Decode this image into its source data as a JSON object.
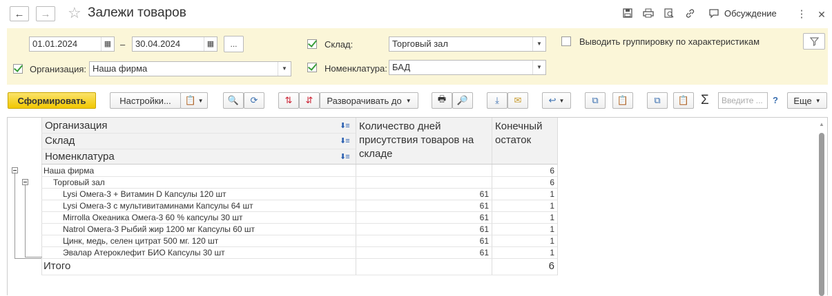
{
  "window": {
    "title": "Залежи товаров",
    "discussion_label": "Обсуждение"
  },
  "filters": {
    "date_from": "01.01.2024",
    "date_separator": "–",
    "date_to": "30.04.2024",
    "period_button": "...",
    "organization": {
      "checked": true,
      "label": "Организация:",
      "value": "Наша фирма"
    },
    "warehouse": {
      "checked": true,
      "label": "Склад:",
      "value": "Торговый зал"
    },
    "nomenclature": {
      "checked": true,
      "label": "Номенклатура:",
      "value": "БАД"
    },
    "grouping": {
      "checked": false,
      "label": "Выводить группировку по характеристикам"
    }
  },
  "toolbar": {
    "generate": "Сформировать",
    "settings": "Настройки...",
    "expand_to": "Разворачивать до",
    "search_placeholder": "Введите ...",
    "help": "?",
    "more": "Еще",
    "sum_symbol": "Σ"
  },
  "report": {
    "headers": {
      "group1": "Организация",
      "group2": "Склад",
      "group3": "Номенклатура",
      "days": "Количество дней присутствия товаров на складе",
      "balance": "Конечный остаток"
    },
    "organization_row": {
      "name": "Наша фирма",
      "days": "",
      "balance": "6"
    },
    "warehouse_row": {
      "name": "Торговый зал",
      "days": "",
      "balance": "6"
    },
    "items": [
      {
        "name": "Lysi Омега-3 + Витамин D Капсулы 120 шт",
        "days": "61",
        "balance": "1"
      },
      {
        "name": "Lysi Омега-3 с мультивитаминами Капсулы 64 шт",
        "days": "61",
        "balance": "1"
      },
      {
        "name": "Mirrolla Океаника Омега-3 60 % капсулы 30 шт",
        "days": "61",
        "balance": "1"
      },
      {
        "name": "Natrol Омега-3 Рыбий жир 1200 мг Капсулы 60 шт",
        "days": "61",
        "balance": "1"
      },
      {
        "name": "Цинк, медь, селен  цитрат 500 мг. 120 шт",
        "days": "61",
        "balance": "1"
      },
      {
        "name": "Эвалар Атероклефит БИО Капсулы 30 шт",
        "days": "61",
        "balance": "1"
      }
    ],
    "total": {
      "label": "Итого",
      "balance": "6"
    }
  }
}
